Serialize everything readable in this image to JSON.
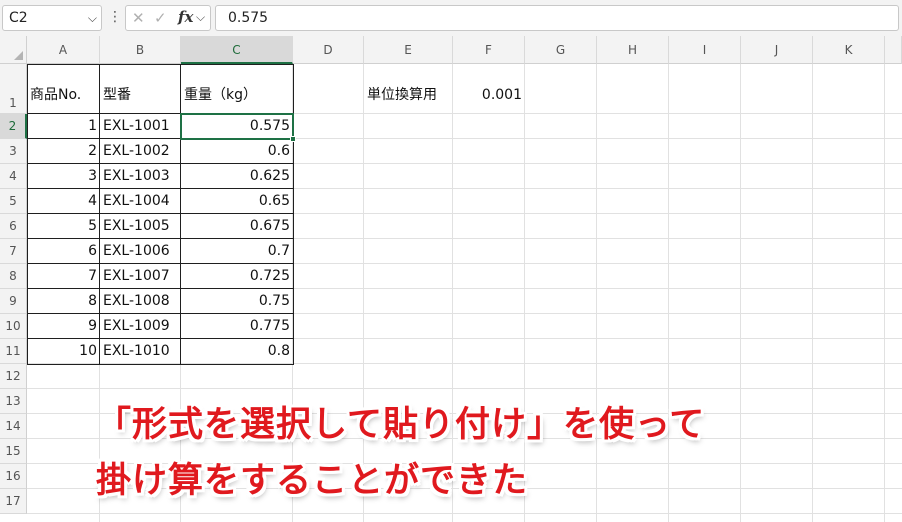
{
  "formula_bar": {
    "name_box": "C2",
    "formula": "0.575",
    "fx_label": "fx"
  },
  "columns": [
    "A",
    "B",
    "C",
    "D",
    "E",
    "F",
    "G",
    "H",
    "I",
    "J",
    "K"
  ],
  "rows": [
    "1",
    "2",
    "3",
    "4",
    "5",
    "6",
    "7",
    "8",
    "9",
    "10",
    "11",
    "12",
    "13",
    "14",
    "15",
    "16",
    "17"
  ],
  "sheet": {
    "headers": {
      "a1": "商品No.",
      "b1": "型番",
      "c1": "重量（kg）"
    },
    "unit_label": "単位換算用",
    "unit_value": "0.001",
    "table_rows": [
      {
        "no": "1",
        "code": "EXL-1001",
        "weight": "0.575"
      },
      {
        "no": "2",
        "code": "EXL-1002",
        "weight": "0.6"
      },
      {
        "no": "3",
        "code": "EXL-1003",
        "weight": "0.625"
      },
      {
        "no": "4",
        "code": "EXL-1004",
        "weight": "0.65"
      },
      {
        "no": "5",
        "code": "EXL-1005",
        "weight": "0.675"
      },
      {
        "no": "6",
        "code": "EXL-1006",
        "weight": "0.7"
      },
      {
        "no": "7",
        "code": "EXL-1007",
        "weight": "0.725"
      },
      {
        "no": "8",
        "code": "EXL-1008",
        "weight": "0.75"
      },
      {
        "no": "9",
        "code": "EXL-1009",
        "weight": "0.775"
      },
      {
        "no": "10",
        "code": "EXL-1010",
        "weight": "0.8"
      }
    ]
  },
  "caption": {
    "line1": "「形式を選択して貼り付け」を使って",
    "line2": "掛け算をすることができた"
  },
  "colors": {
    "accent": "#1e7145",
    "caption": "#e0191e"
  }
}
